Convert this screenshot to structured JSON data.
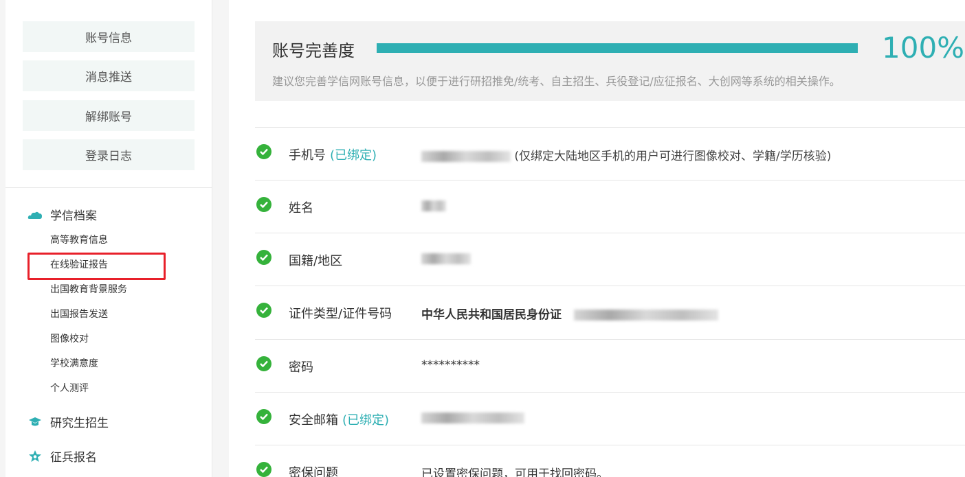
{
  "sidebar": {
    "buttons": [
      "账号信息",
      "消息推送",
      "解绑账号",
      "登录日志"
    ],
    "sections": [
      {
        "title": "学信档案",
        "icon": "cloud-icon",
        "items": [
          "高等教育信息",
          "在线验证报告",
          "出国教育背景服务",
          "出国报告发送",
          "图像校对",
          "学校满意度",
          "个人测评"
        ]
      },
      {
        "title": "研究生招生",
        "icon": "graduation-cap-icon",
        "items": []
      },
      {
        "title": "征兵报名",
        "icon": "star-badge-icon",
        "items": []
      }
    ],
    "highlighted_item": "在线验证报告"
  },
  "completeness": {
    "title": "账号完善度",
    "percent_text": "100%",
    "progress": 1.0,
    "description": "建议您完善学信网账号信息，以便于进行研招推免/统考、自主招生、兵役登记/应征报名、大创网等系统的相关操作。"
  },
  "rows": [
    {
      "label": "手机号",
      "bound": "(已绑定)",
      "value": "",
      "note": "(仅绑定大陆地区手机的用户可进行图像校对、学籍/学历核验)"
    },
    {
      "label": "姓名",
      "bound": "",
      "value": ""
    },
    {
      "label": "国籍/地区",
      "bound": "",
      "value": ""
    },
    {
      "label": "证件类型/证件号码",
      "bound": "",
      "value": "中华人民共和国居民身份证"
    },
    {
      "label": "密码",
      "bound": "",
      "value": "**********"
    },
    {
      "label": "安全邮箱",
      "bound": "(已绑定)",
      "value": ""
    },
    {
      "label": "密保问题",
      "bound": "",
      "value": "已设置密保问题，可用于找回密码。"
    }
  ],
  "colors": {
    "accent": "#2eafb3",
    "check": "#35b23b",
    "highlight": "#e8202a"
  }
}
